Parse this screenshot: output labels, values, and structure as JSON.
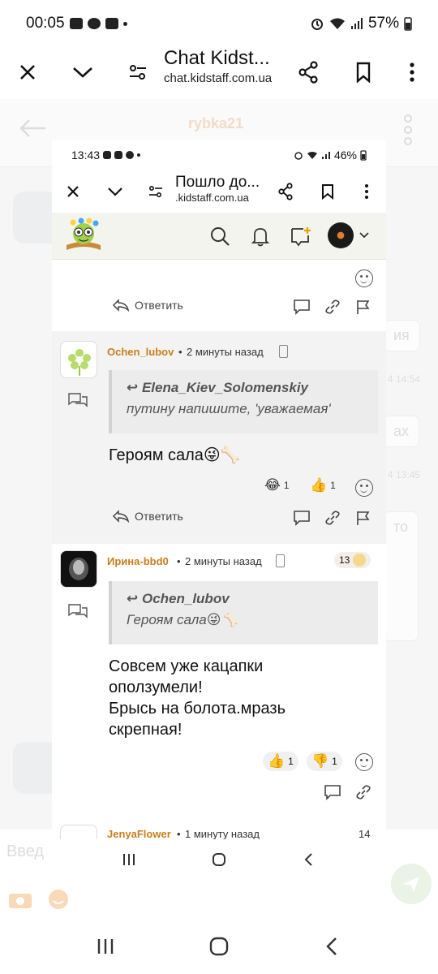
{
  "status_bar": {
    "time": "00:05",
    "battery": "57%"
  },
  "browser": {
    "title": "Chat Kidst...",
    "url": "chat.kidstaff.com.ua"
  },
  "background_chat": {
    "username": "rybka21",
    "input_placeholder": "Введ",
    "bubbles": [
      {
        "text": "ия"
      },
      {
        "text": "ах"
      },
      {
        "text": "то"
      }
    ],
    "times": [
      "4 14:54",
      "4 13:45"
    ]
  },
  "inner": {
    "status_bar": {
      "time": "13:43",
      "battery": "46%"
    },
    "browser": {
      "title": "Пошло до...",
      "url": ".kidstaff.com.ua"
    },
    "reply_label": "Ответить",
    "posts": [
      {
        "username": "Ochen_lubov",
        "time": "2 минуты назад",
        "quote_author": "Elena_Kiev_Solomenskiy",
        "quote_text": "путину напишите, 'уважаемая'",
        "message": "Героям сала😜🦴",
        "reactions": [
          {
            "emoji": "😂",
            "count": "1"
          },
          {
            "emoji": "👍",
            "count": "1"
          }
        ]
      },
      {
        "username": "Ирина-bbd0",
        "time": "2 минуты назад",
        "badge": "13",
        "quote_author": "Ochen_lubov",
        "quote_text": "Героям сала😜🦴",
        "message_lines": [
          "Совсем уже кацапки",
          "оползумели!",
          "Брысь на болота.мразь",
          "скрепная!"
        ],
        "reactions": [
          {
            "emoji": "👍",
            "count": "1"
          },
          {
            "emoji": "👎",
            "count": "1"
          }
        ]
      },
      {
        "username": "JenyaFlower",
        "time": "1 минуту назад",
        "badge": "14"
      }
    ]
  },
  "colors": {
    "username": "#c87e1c",
    "quote_bg": "#ececec",
    "post_alt_bg": "#f3f3f3"
  }
}
